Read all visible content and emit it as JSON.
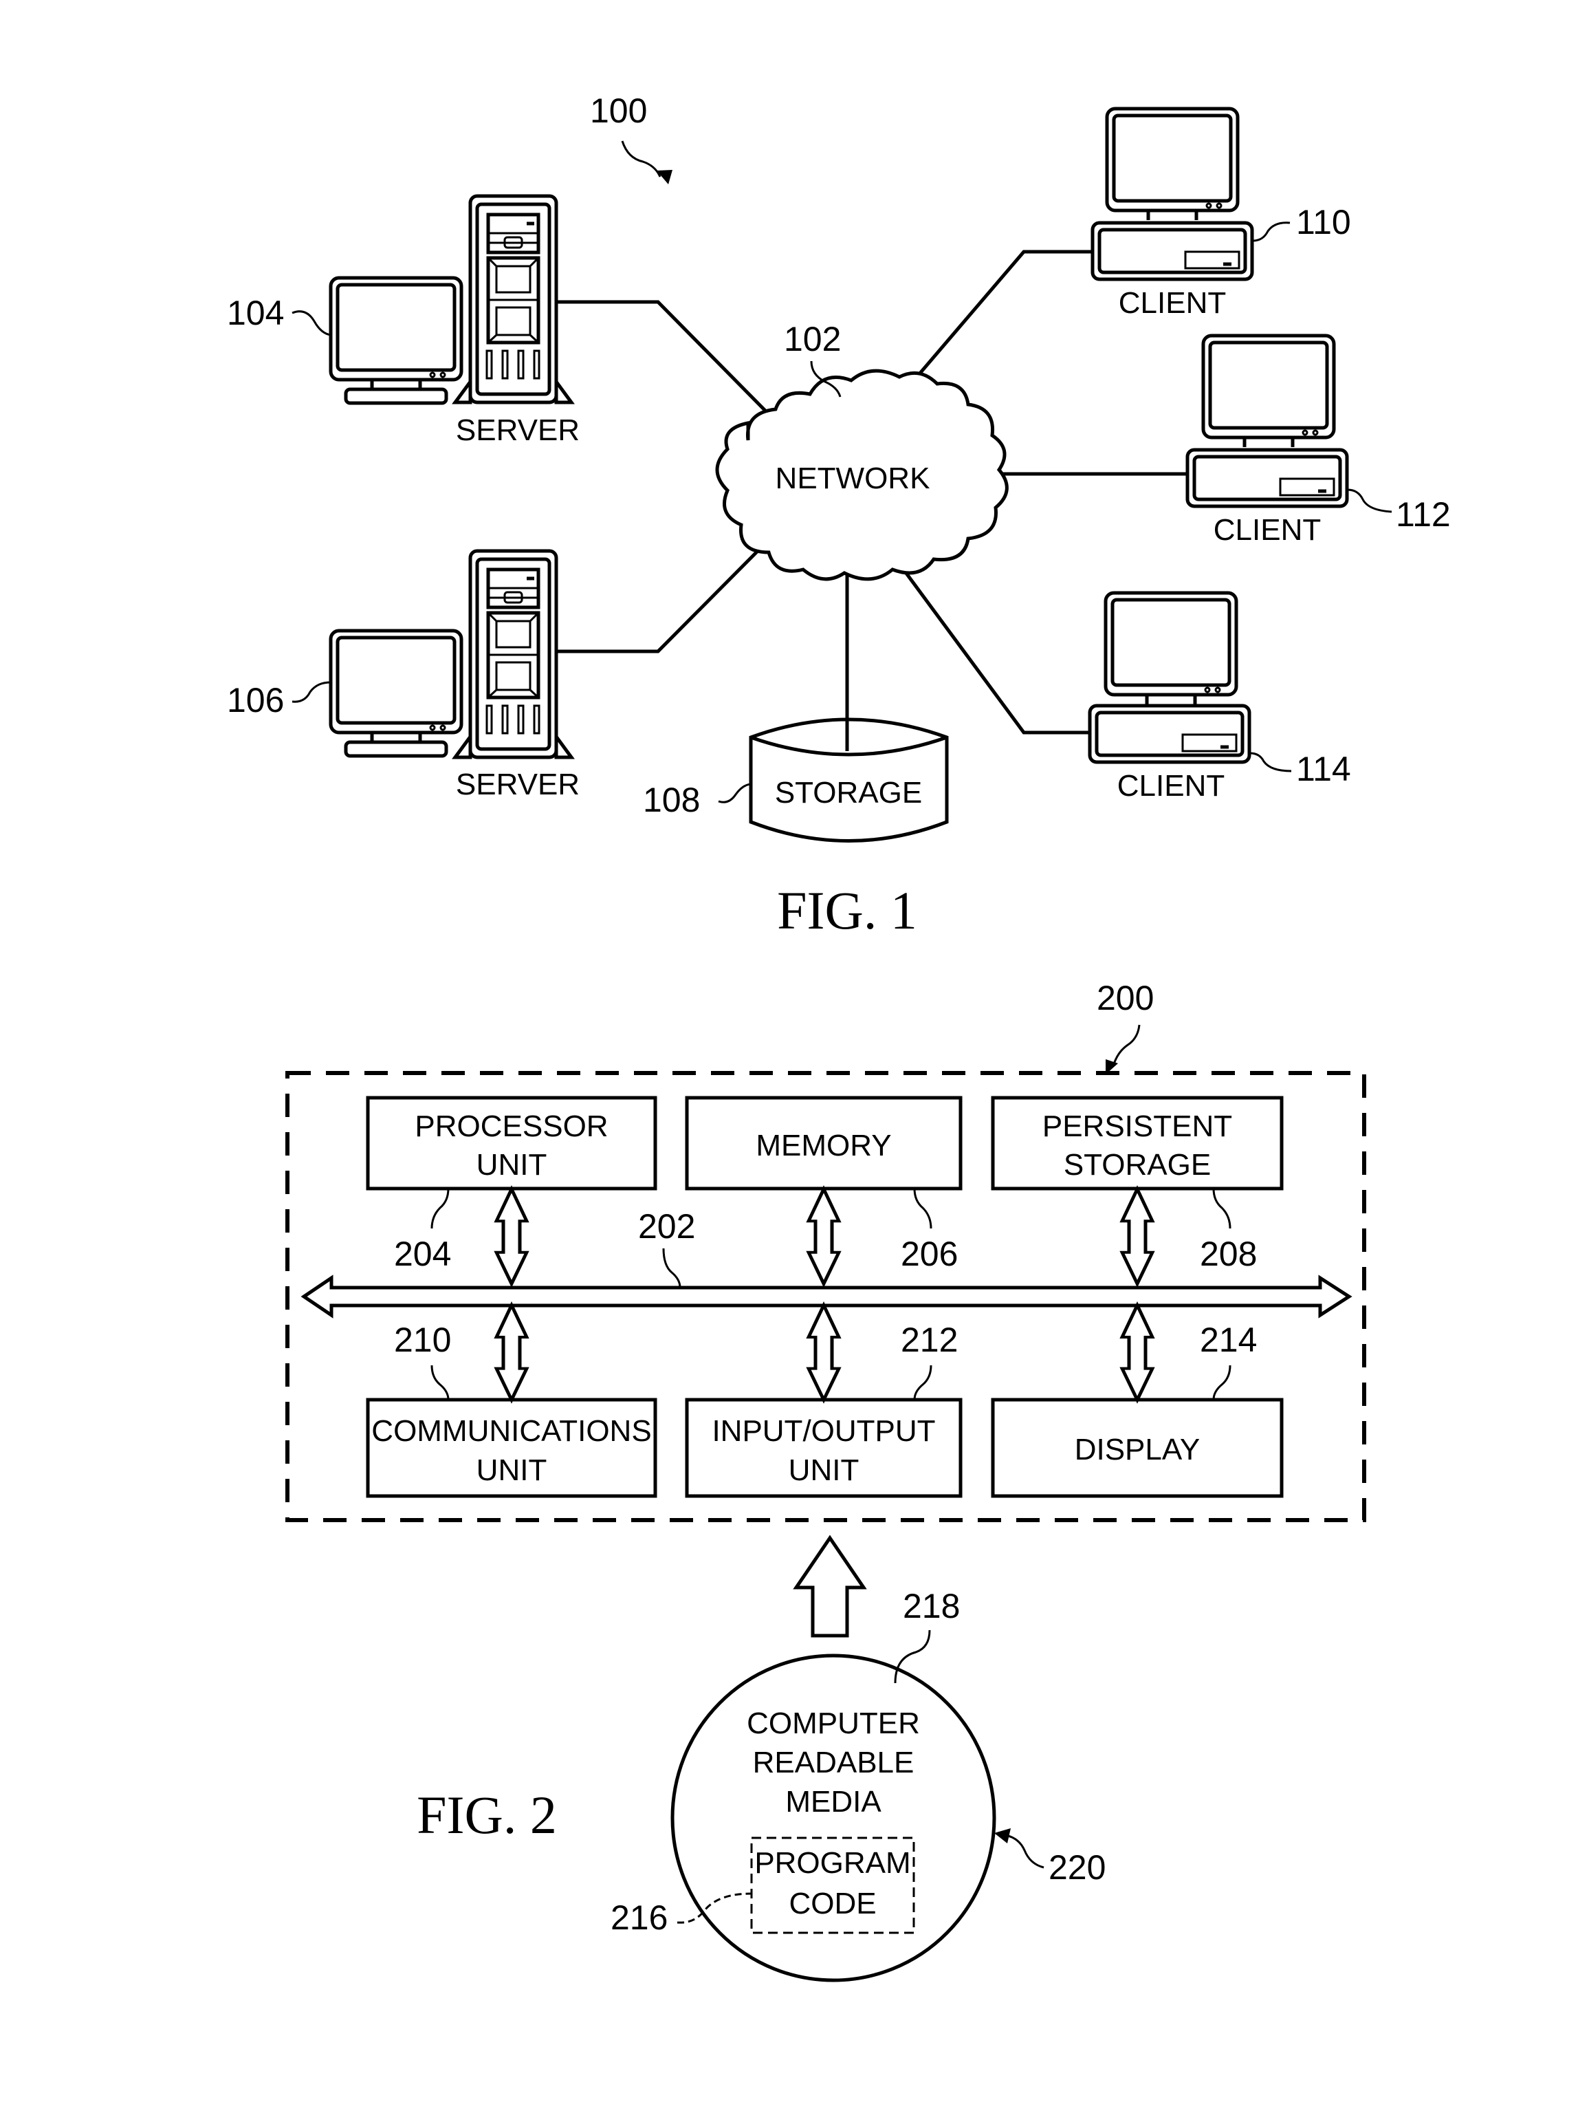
{
  "figure1": {
    "caption": "FIG. 1",
    "system_ref": "100",
    "network": {
      "label": "NETWORK",
      "ref": "102"
    },
    "servers": [
      {
        "label": "SERVER",
        "ref": "104"
      },
      {
        "label": "SERVER",
        "ref": "106"
      }
    ],
    "storage": {
      "label": "STORAGE",
      "ref": "108"
    },
    "clients": [
      {
        "label": "CLIENT",
        "ref": "110"
      },
      {
        "label": "CLIENT",
        "ref": "112"
      },
      {
        "label": "CLIENT",
        "ref": "114"
      }
    ]
  },
  "figure2": {
    "caption": "FIG. 2",
    "system_ref": "200",
    "bus_ref": "202",
    "top_blocks": [
      {
        "line1": "PROCESSOR",
        "line2": "UNIT",
        "ref": "204"
      },
      {
        "line1": "MEMORY",
        "line2": "",
        "ref": "206"
      },
      {
        "line1": "PERSISTENT",
        "line2": "STORAGE",
        "ref": "208"
      }
    ],
    "bottom_blocks": [
      {
        "line1": "COMMUNICATIONS",
        "line2": "UNIT",
        "ref": "210"
      },
      {
        "line1": "INPUT/OUTPUT",
        "line2": "UNIT",
        "ref": "212"
      },
      {
        "line1": "DISPLAY",
        "line2": "",
        "ref": "214"
      }
    ],
    "media": {
      "line1": "COMPUTER",
      "line2": "READABLE",
      "line3": "MEDIA",
      "ref": "218",
      "product_ref": "220",
      "program_code": {
        "line1": "PROGRAM",
        "line2": "CODE",
        "ref": "216"
      }
    }
  }
}
